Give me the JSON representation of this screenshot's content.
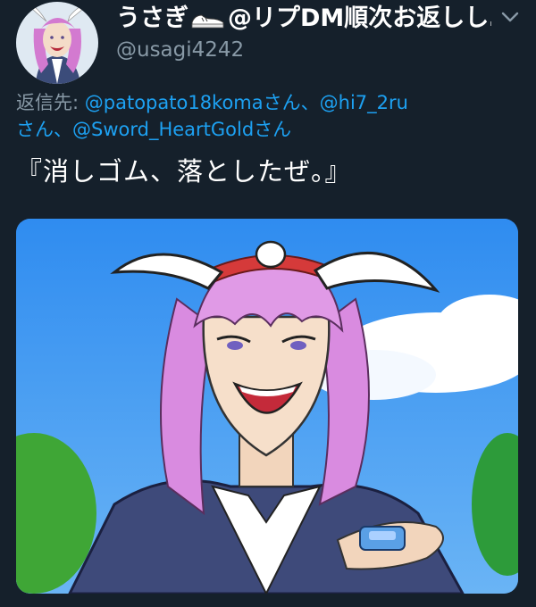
{
  "author": {
    "display_name_prefix": "うさぎ",
    "display_name_suffix": "@リプDM順次お返しし…",
    "handle": "@usagi4242",
    "avatar_icon": "bunny-character-avatar"
  },
  "menu": {
    "icon": "chevron-down-icon"
  },
  "reply": {
    "label": "返信先:",
    "mentions": [
      "@patopato18komaさん、",
      "@hi7_2ru",
      "さん、",
      "@Sword_HeartGoldさん"
    ]
  },
  "tweet": {
    "text": "『消しゴム、落としたぜ。』"
  },
  "media": {
    "icon": "bunny-ears-character-illustration"
  },
  "colors": {
    "background": "#15202b",
    "accent": "#1da1f2",
    "secondary_text": "#8899a6"
  }
}
